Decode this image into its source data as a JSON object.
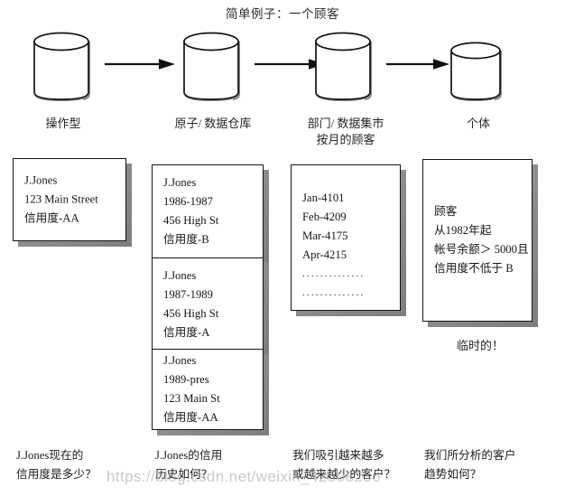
{
  "title": "简单例子：一个顾客",
  "flow": {
    "nodes": [
      {
        "icon": "database-cylinder-icon",
        "label": "操作型",
        "sublabel": ""
      },
      {
        "icon": "database-cylinder-icon",
        "label": "原子/ 数据仓库",
        "sublabel": ""
      },
      {
        "icon": "database-cylinder-icon",
        "label": "部门/ 数据集市",
        "sublabel": "按月的顾客"
      },
      {
        "icon": "database-cylinder-icon",
        "label": "个体",
        "sublabel": ""
      }
    ],
    "arrows": [
      {
        "name": "arrow-operational-to-atomic"
      },
      {
        "name": "arrow-atomic-to-departmental"
      },
      {
        "name": "arrow-departmental-to-individual"
      }
    ]
  },
  "cards": [
    {
      "name": "card-operational-current",
      "lines": [
        "J.Jones",
        "123   Main Street",
        "信用度-AA"
      ]
    },
    {
      "name": "card-warehouse-1986-1987",
      "lines": [
        "J.Jones",
        "1986-1987",
        "456   High St",
        "信用度-B"
      ]
    },
    {
      "name": "card-warehouse-1987-1989",
      "lines": [
        "J.Jones",
        "1987-1989",
        "456   High St",
        "信用度-A"
      ]
    },
    {
      "name": "card-warehouse-1989-pres",
      "lines": [
        "J.Jones",
        "1989-pres",
        "123   Main St",
        "信用度-AA"
      ]
    },
    {
      "name": "card-datamart-monthly",
      "lines": [
        "Jan-4101",
        "Feb-4209",
        "Mar-4175",
        "Apr-4215",
        "..............",
        ".............."
      ]
    },
    {
      "name": "card-individual-query",
      "lines": [
        "顾客",
        "从1982年起",
        "帐号余额＞ 5000且",
        "信用度不低于 B"
      ]
    }
  ],
  "temporary_note": "临时的！",
  "questions": [
    {
      "name": "question-current-credit",
      "lines": [
        "J.Jones现在的",
        "信用度是多少？"
      ]
    },
    {
      "name": "question-credit-history",
      "lines": [
        "J.Jones的信用",
        "历史如何？"
      ]
    },
    {
      "name": "question-customer-trend",
      "lines": [
        "我们吸引越来越多",
        "或越来越少的客户？"
      ]
    },
    {
      "name": "question-analysis-trend",
      "lines": [
        "我们所分析的客户",
        "趋势如何？"
      ]
    }
  ],
  "watermark": "https://blog.csdn.net/weixin_42508236"
}
